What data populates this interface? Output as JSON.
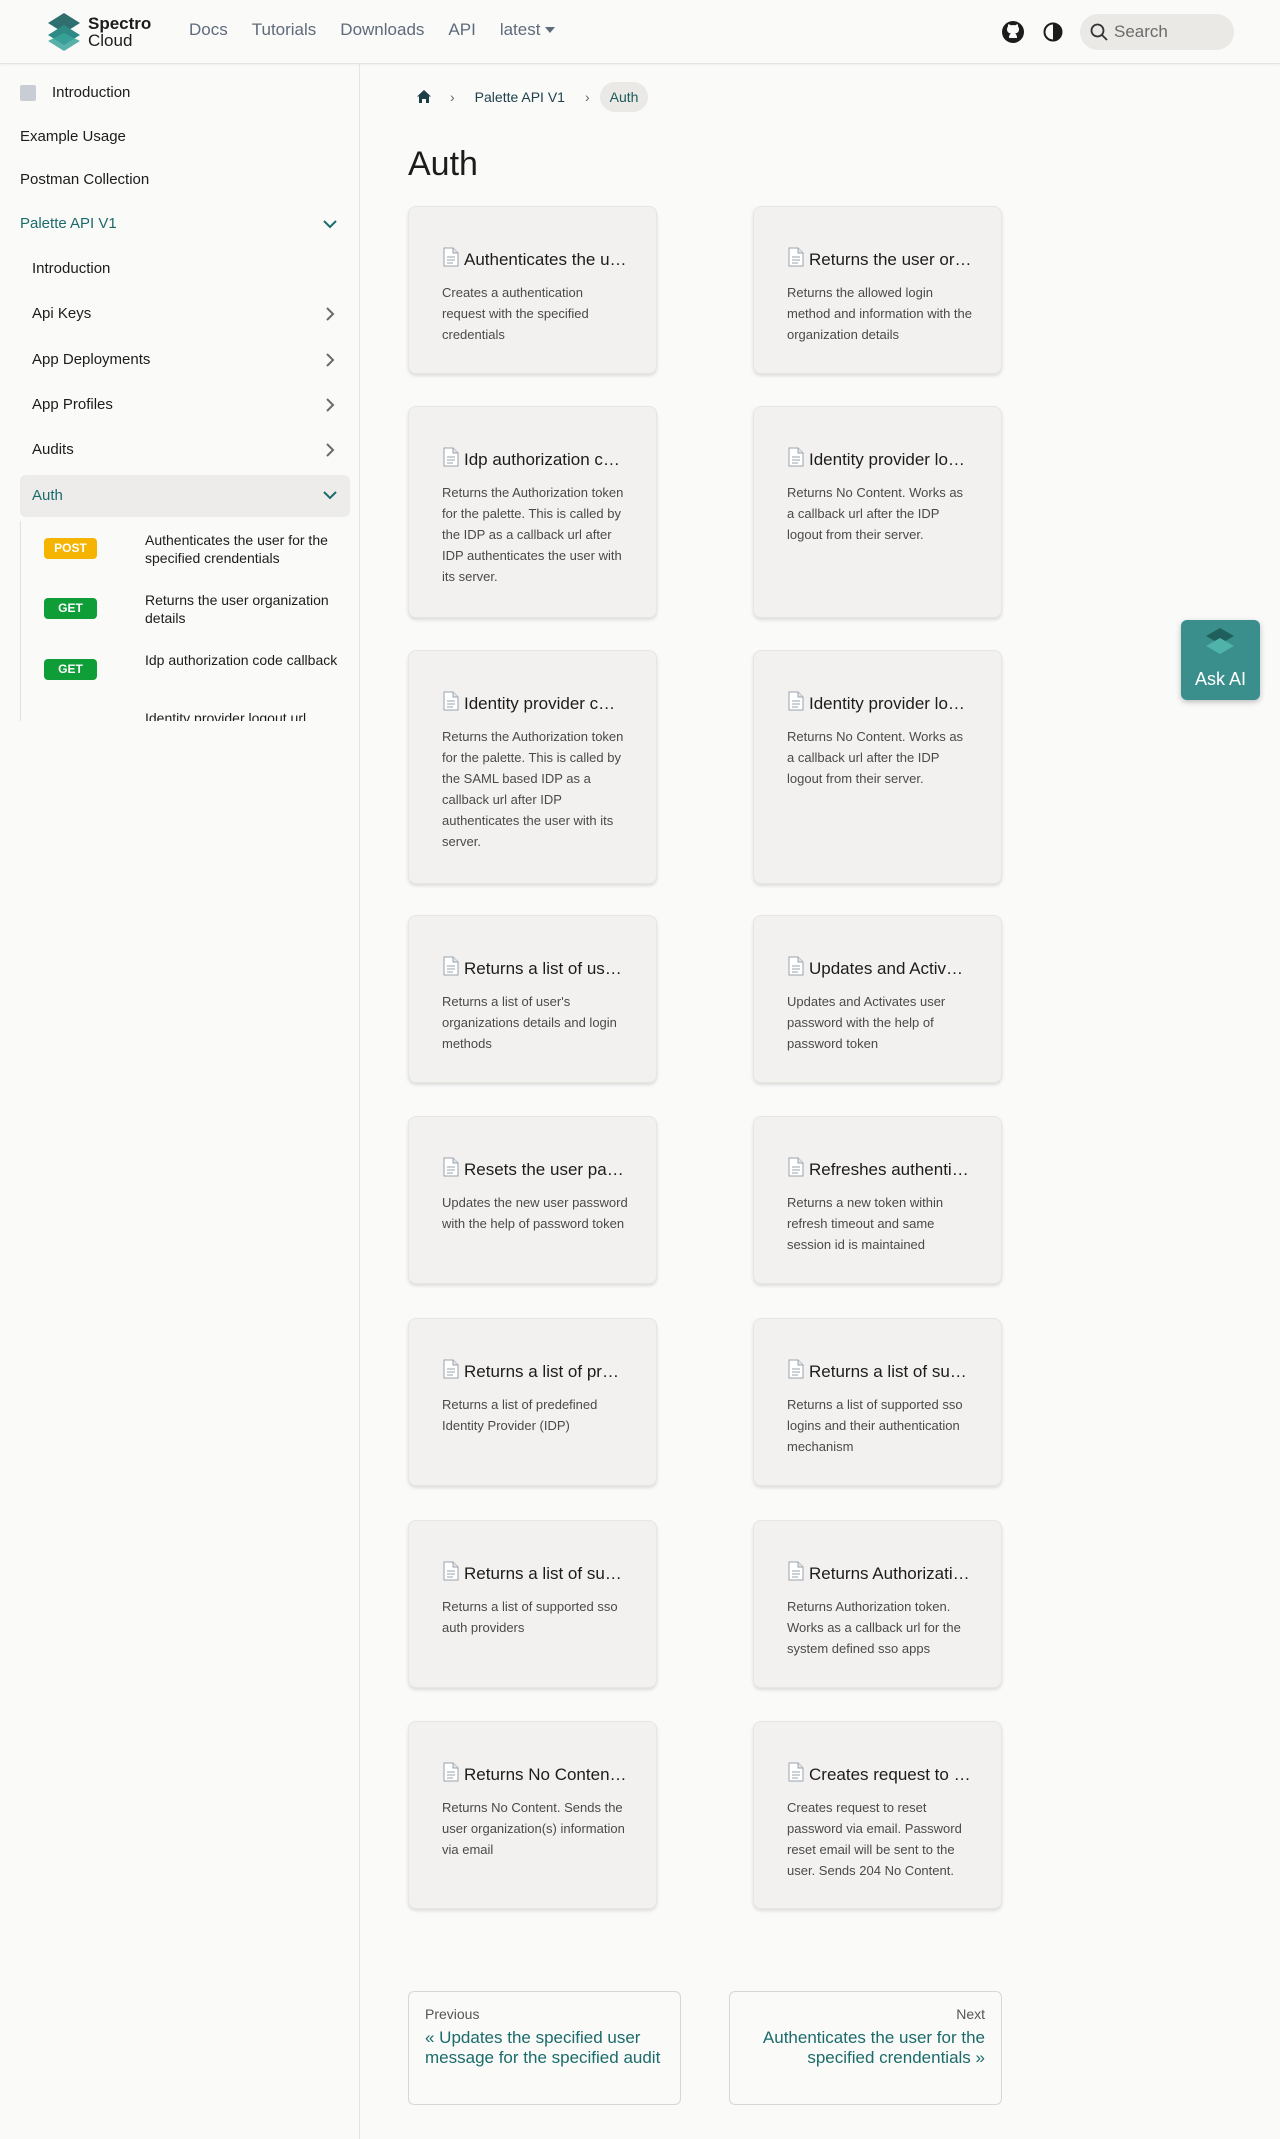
{
  "brand": {
    "line1": "Spectro",
    "line2": "Cloud"
  },
  "nav": {
    "links": [
      "Docs",
      "Tutorials",
      "Downloads",
      "API"
    ],
    "version": "latest",
    "search_placeholder": "Search"
  },
  "sidebar": {
    "items": [
      {
        "label": "Introduction"
      },
      {
        "label": "Example Usage"
      },
      {
        "label": "Postman Collection"
      },
      {
        "label": "Palette API V1"
      }
    ],
    "sub_items": [
      {
        "label": "Introduction"
      },
      {
        "label": "Api Keys"
      },
      {
        "label": "App Deployments"
      },
      {
        "label": "App Profiles"
      },
      {
        "label": "Audits"
      }
    ],
    "auth_label": "Auth",
    "operations": [
      {
        "method": "POST",
        "label": "Authenticates the user for the specified crendentials"
      },
      {
        "method": "GET",
        "label": "Returns the user organization details"
      },
      {
        "method": "GET",
        "label": "Idp authorization code callback"
      },
      {
        "method": "",
        "label": "Identity provider logout url"
      }
    ]
  },
  "breadcrumb": {
    "items": [
      "Palette API V1",
      "Auth"
    ]
  },
  "page_title": "Auth",
  "cards": [
    {
      "title": "Authenticates the u…",
      "desc": "Creates a authentication request with the specified credentials"
    },
    {
      "title": "Returns the user or…",
      "desc": "Returns the allowed login method and information with the organization details"
    },
    {
      "title": "Idp authorization c…",
      "desc": "Returns the Authorization token for the palette. This is called by the IDP as a callback url after IDP authenticates the user with its server."
    },
    {
      "title": "Identity provider lo…",
      "desc": "Returns No Content. Works as a callback url after the IDP logout from their server."
    },
    {
      "title": "Identity provider c…",
      "desc": "Returns the Authorization token for the palette. This is called by the SAML based IDP as a callback url after IDP authenticates the user with its server."
    },
    {
      "title": "Identity provider lo…",
      "desc": "Returns No Content. Works as a callback url after the IDP logout from their server."
    },
    {
      "title": "Returns a list of use…",
      "desc": "Returns a list of user's organizations details and login methods"
    },
    {
      "title": "Updates and Activ…",
      "desc": "Updates and Activates user password with the help of password token"
    },
    {
      "title": "Resets the user pas…",
      "desc": "Updates the new user password with the help of password token"
    },
    {
      "title": "Refreshes authenti…",
      "desc": "Returns a new token within refresh timeout and same session id is maintained"
    },
    {
      "title": "Returns a list of pre…",
      "desc": "Returns a list of predefined Identity Provider (IDP)"
    },
    {
      "title": "Returns a list of sup…",
      "desc": "Returns a list of supported sso logins and their authentication mechanism"
    },
    {
      "title": "Returns a list of sup…",
      "desc": "Returns a list of supported sso auth providers"
    },
    {
      "title": "Returns Authorizati…",
      "desc": "Returns Authorization token. Works as a callback url for the system defined sso apps"
    },
    {
      "title": "Returns No Content…",
      "desc": "Returns No Content. Sends the user organization(s) information via email"
    },
    {
      "title": "Creates request to …",
      "desc": "Creates request to reset password via email. Password reset email will be sent to the user. Sends 204 No Content."
    }
  ],
  "pager": {
    "prev_sub": "Previous",
    "prev_label": "« Updates the specified user message for the specified audit",
    "next_sub": "Next",
    "next_label": "Authenticates the user for the specified crendentials »"
  },
  "ask_ai": "Ask AI",
  "colors": {
    "accent": "#1b6b6b",
    "ask_ai_bg": "#3a8f8c",
    "post": "#f4b400",
    "get": "#0f9d38"
  }
}
